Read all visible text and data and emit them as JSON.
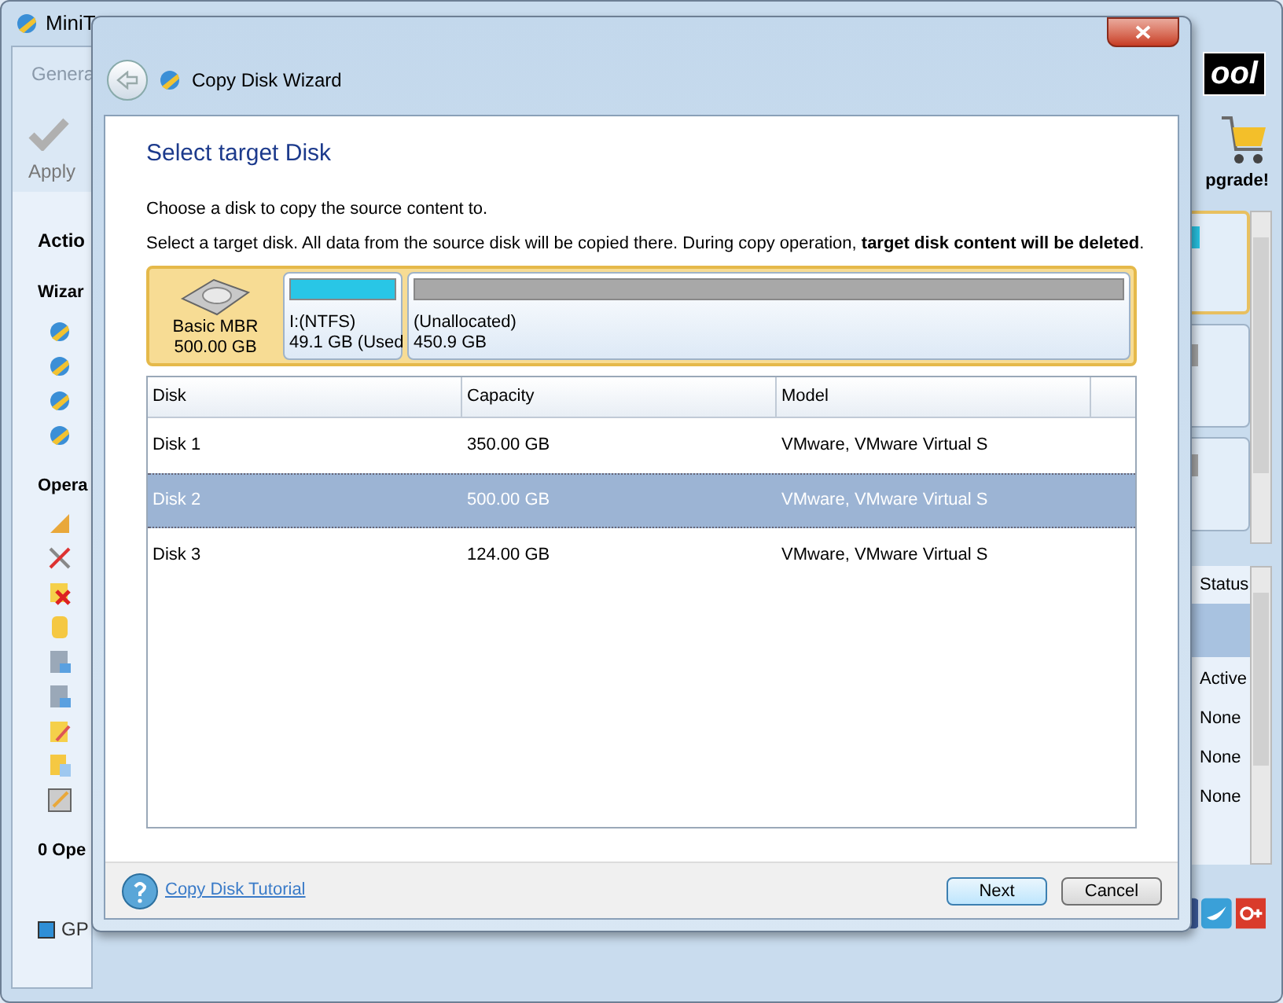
{
  "background_window": {
    "title": "MiniT",
    "tab": "Genera",
    "apply": "Apply",
    "sections": [
      {
        "kind": "heading",
        "text": "Actio"
      },
      {
        "kind": "group",
        "text": "Wizar"
      },
      {
        "kind": "icons",
        "icons": [
          {
            "kind": "wizard"
          },
          {
            "kind": "wizard"
          },
          {
            "kind": "wizard"
          },
          {
            "kind": "wizard"
          }
        ]
      },
      {
        "kind": "group",
        "text": "Opera"
      },
      {
        "kind": "icons",
        "icons": [
          {
            "kind": "ruler"
          },
          {
            "kind": "tools"
          },
          {
            "kind": "delete"
          },
          {
            "kind": "cylinder"
          },
          {
            "kind": "doc"
          },
          {
            "kind": "doc"
          },
          {
            "kind": "pencil"
          },
          {
            "kind": "copy"
          },
          {
            "kind": "gpt"
          }
        ]
      },
      {
        "kind": "group",
        "text": "0 Ope"
      }
    ],
    "legend": "GP",
    "logo": "ool",
    "upgrade": "pgrade!",
    "status_header": "Status",
    "status_rows": [
      {
        "text": "Active"
      },
      {
        "text": "None"
      },
      {
        "text": "None"
      },
      {
        "text": "None"
      }
    ]
  },
  "dialog": {
    "title": "Copy Disk Wizard",
    "heading": "Select target Disk",
    "intro": "Choose a disk to copy the source content to.",
    "instruction": "Select a target disk. All data from the source disk will be copied there. During copy operation, **target disk content will be deleted**.",
    "disk_map": {
      "selected": true,
      "disk_label": "Basic MBR",
      "disk_size": "500.00 GB",
      "partitions": [
        {
          "label": "I:(NTFS)",
          "size": "49.1 GB (Used",
          "color": "#29c6e6"
        },
        {
          "label": "(Unallocated)",
          "size": "450.9 GB",
          "color": "#a8a8a8"
        }
      ]
    },
    "table": {
      "columns": [
        "Disk",
        "Capacity",
        "Model"
      ],
      "rows": [
        {
          "cells": [
            "Disk 1",
            "350.00 GB",
            "VMware, VMware Virtual S"
          ],
          "selected": false
        },
        {
          "cells": [
            "Disk 2",
            "500.00 GB",
            "VMware, VMware Virtual S"
          ],
          "selected": true
        },
        {
          "cells": [
            "Disk 3",
            "124.00 GB",
            "VMware, VMware Virtual S"
          ],
          "selected": false
        }
      ]
    },
    "tutorial_link": "Copy Disk Tutorial",
    "buttons": [
      {
        "label": "Next",
        "kind": "default"
      },
      {
        "label": "Cancel",
        "kind": "normal"
      }
    ]
  }
}
